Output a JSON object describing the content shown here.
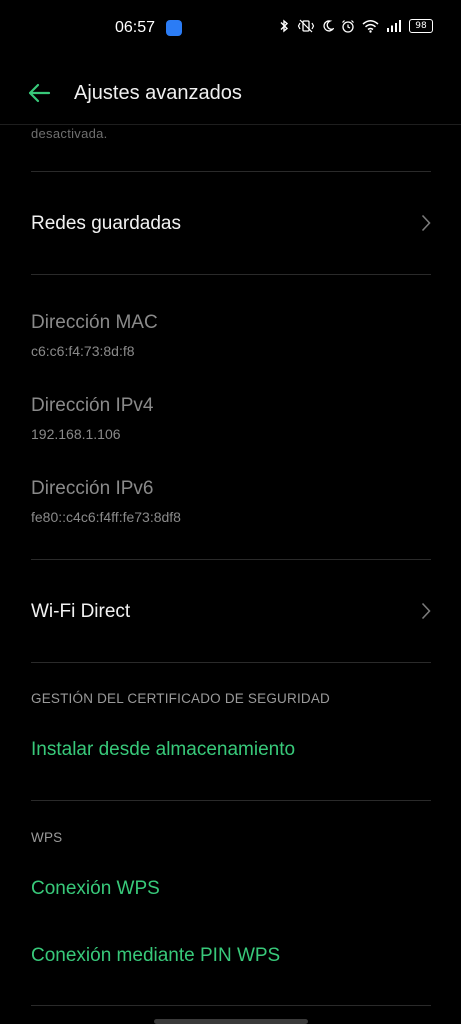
{
  "status_bar": {
    "time": "06:57",
    "battery": "98",
    "icons": [
      "bluetooth-icon",
      "vibrate-icon",
      "do-not-disturb-icon",
      "alarm-icon",
      "wifi-icon",
      "signal-icon",
      "battery-icon"
    ]
  },
  "header": {
    "title": "Ajustes avanzados",
    "back_icon": "back-arrow-icon"
  },
  "content": {
    "clipped_text": "desactivada.",
    "saved_networks": {
      "label": "Redes guardadas"
    },
    "mac": {
      "label": "Dirección MAC",
      "value": "c6:c6:f4:73:8d:f8"
    },
    "ipv4": {
      "label": "Dirección IPv4",
      "value": "192.168.1.106"
    },
    "ipv6": {
      "label": "Dirección IPv6",
      "value": "fe80::c4c6:f4ff:fe73:8df8"
    },
    "wifi_direct": {
      "label": "Wi-Fi Direct"
    },
    "cert_section": {
      "header": "GESTIÓN DEL CERTIFICADO DE SEGURIDAD",
      "install": "Instalar desde almacenamiento"
    },
    "wps_section": {
      "header": "WPS",
      "connect": "Conexión WPS",
      "pin": "Conexión mediante PIN WPS"
    }
  },
  "colors": {
    "accent": "#38c97a",
    "background": "#000000",
    "muted": "#8a8a8a"
  }
}
